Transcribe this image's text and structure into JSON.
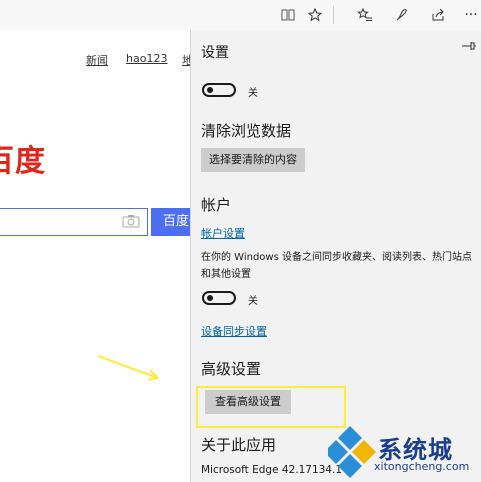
{
  "toolbar": {
    "icons": [
      "reading-view-icon",
      "favorite-star-icon",
      "favorites-list-icon",
      "pen-icon",
      "share-icon",
      "more-icon"
    ],
    "more_label": "···"
  },
  "page": {
    "nav": [
      "新闻",
      "hao123",
      "地"
    ],
    "logo_text": "百度",
    "search_button": "百度一下"
  },
  "settings": {
    "title": "设置",
    "toggle_off_label": "关",
    "clear_section": "清除浏览数据",
    "clear_button": "选择要清除的内容",
    "account_section": "帐户",
    "account_link": "帐户设置",
    "sync_desc": "在你的 Windows 设备之间同步收藏夹、阅读列表、热门站点和其他设置",
    "sync_toggle_label": "关",
    "sync_link": "设备同步设置",
    "advanced_section": "高级设置",
    "advanced_button": "查看高级设置",
    "about_section": "关于此应用",
    "about_value": "Microsoft Edge 42.17134.1"
  },
  "watermark": {
    "text": "系统城",
    "url": "xitongcheng.com"
  },
  "colors": {
    "accent_link": "#0063b1",
    "highlight": "#ffec3d",
    "baidu_red": "#e1251b",
    "baidu_blue": "#4e6ef2"
  }
}
